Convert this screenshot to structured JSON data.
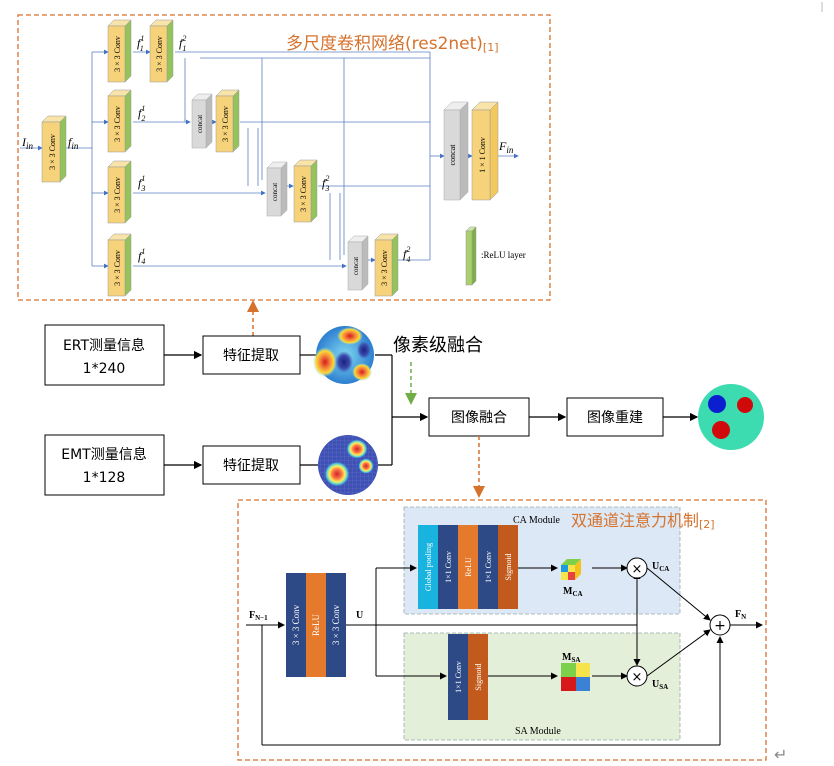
{
  "res2net": {
    "title": "多尺度卷积网络(res2net)",
    "title_ref": "[1]",
    "input_label": "I",
    "input_sub": "in",
    "fin_label": "f",
    "fin_sub": "in",
    "output_label": "F",
    "output_sub": "in",
    "conv3": "3 × 3 Conv",
    "conv1": "1 × 1 Conv",
    "concat": "concat",
    "f11": "f",
    "f11_sup": "1",
    "f11_sub": "1",
    "f12": "f",
    "f12_sup": "2",
    "f12_sub": "1",
    "f21": "f",
    "f21_sup": "1",
    "f21_sub": "2",
    "f31": "f",
    "f31_sup": "1",
    "f31_sub": "3",
    "f32": "f",
    "f32_sup": "2",
    "f32_sub": "3",
    "f41": "f",
    "f41_sup": "1",
    "f41_sub": "4",
    "f42": "f",
    "f42_sup": "2",
    "f42_sub": "4",
    "relu_legend": ":ReLU layer"
  },
  "pipeline": {
    "ert_line1": "ERT测量信息",
    "ert_line2": "1*240",
    "emt_line1": "EMT测量信息",
    "emt_line2": "1*128",
    "feature_extract": "特征提取",
    "pixel_fusion": "像素级融合",
    "image_fusion": "图像融合",
    "image_recon": "图像重建"
  },
  "attention": {
    "title": "双通道注意力机制",
    "title_ref": "[2]",
    "ca_module": "CA Module",
    "sa_module": "SA Module",
    "global_pooling": "Global pooling",
    "conv1": "1×1 Conv",
    "relu": "ReLU",
    "sigmoid": "Sigmoid",
    "conv3": "3 × 3 Conv",
    "relu_block": "ReLU",
    "fn1": "F",
    "fn1_sub": "N−1",
    "u": "U",
    "mca": "M",
    "mca_sub": "CA",
    "msa": "M",
    "msa_sub": "SA",
    "uca": "U",
    "uca_sub": "CA",
    "usa": "U",
    "usa_sub": "SA",
    "fn": "F",
    "fn_sub": "N",
    "times": "×",
    "plus": "+"
  },
  "return_mark": "↵",
  "colors": {
    "orange_dashed": "#d5722d",
    "green_dashed": "#70ad47",
    "conv_yellow": "#f6d27a",
    "relu_green": "#a9d16a",
    "concat_grey": "#d9d9d9",
    "att_blue": "#2e4a86",
    "att_orange": "#e57a2c",
    "att_cyan": "#19b3e0",
    "ca_bg": "#dce8f5",
    "sa_bg": "#e3efd9"
  }
}
